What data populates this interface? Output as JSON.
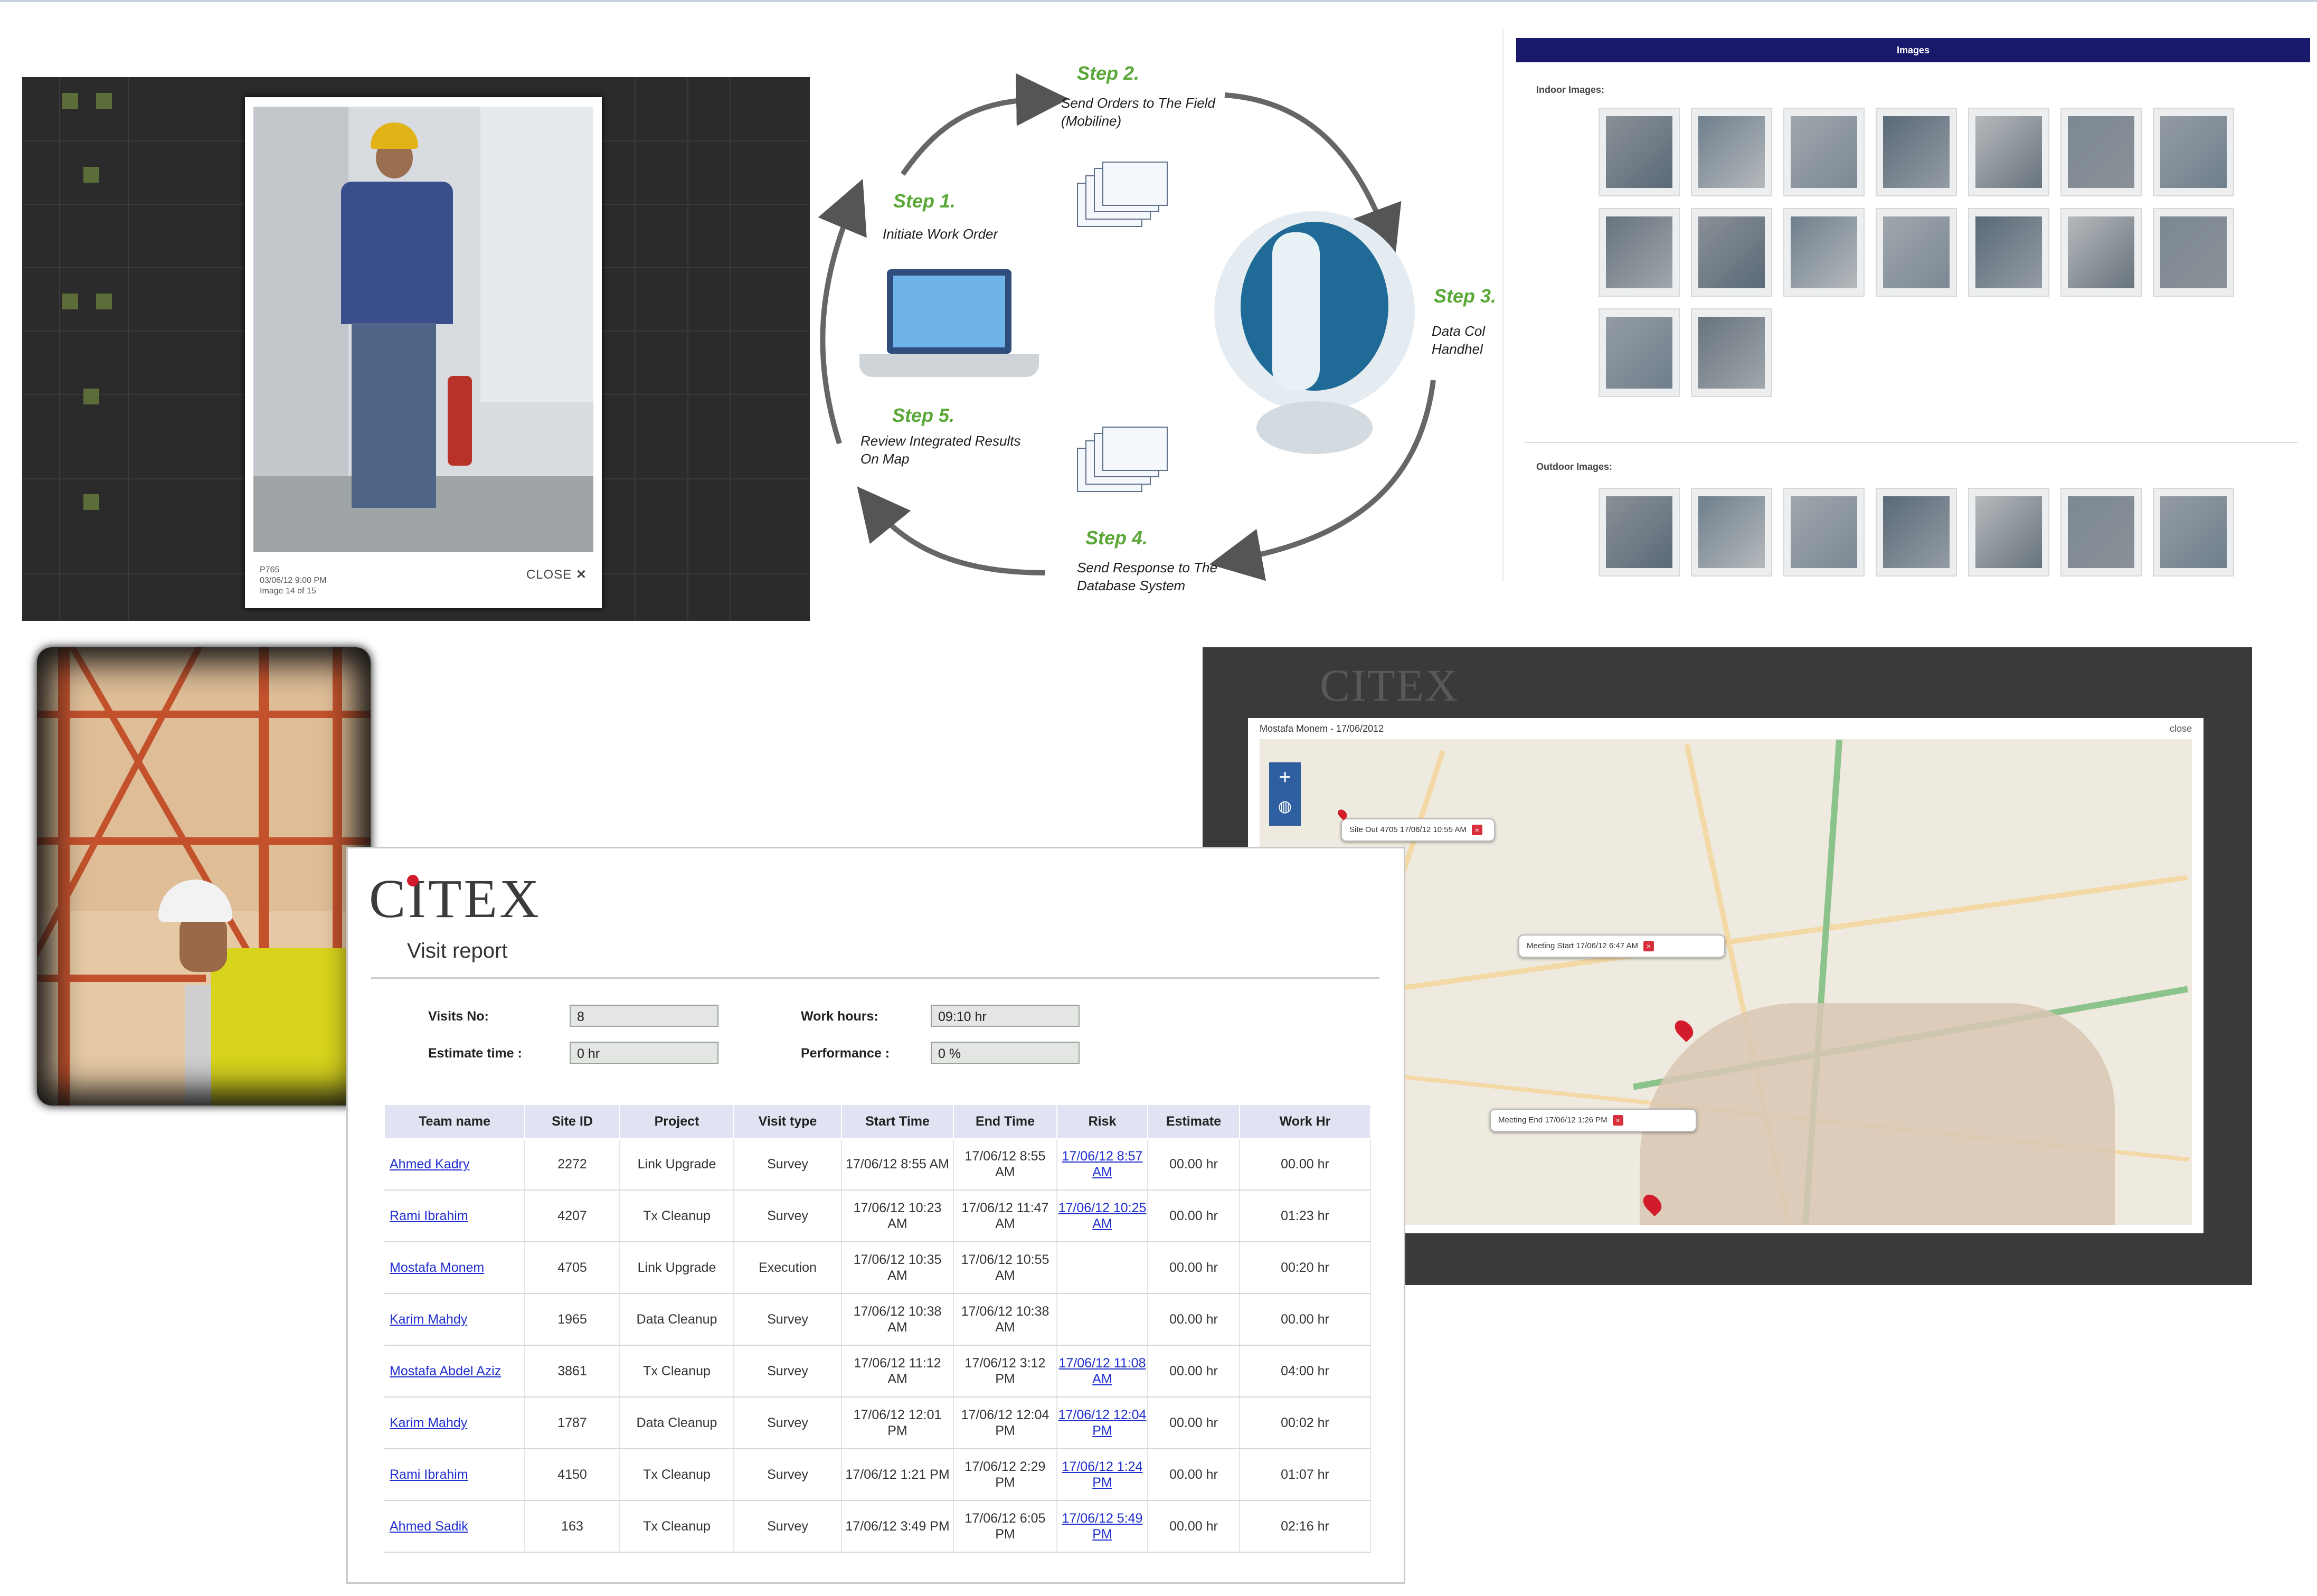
{
  "panel_site_visit": {
    "close_label": "CLOSE",
    "close_icon": "x-icon",
    "caption_lines": [
      "P765",
      "03/06/12 9:00 PM",
      "Image 14 of 15"
    ]
  },
  "workflow": {
    "steps": [
      {
        "title": "Step 1.",
        "desc": "Initiate Work Order"
      },
      {
        "title": "Step 2.",
        "desc": "Send Orders to The Field  (Mobiline)"
      },
      {
        "title": "Step 3.",
        "desc": "Data Col Handhel"
      },
      {
        "title": "Step 4.",
        "desc": "Send Response to The Database System"
      },
      {
        "title": "Step 5.",
        "desc": "Review Integrated Results On Map"
      }
    ],
    "accent_color": "#5aa838"
  },
  "images_panel": {
    "header": "Images",
    "indoor_label": "Indoor Images:",
    "outdoor_label": "Outdoor Images:",
    "indoor_count": 16,
    "outdoor_count": 7
  },
  "map_panel": {
    "logo": "CITEX",
    "title": "Mostafa Monem - 17/06/2012",
    "close_label": "close",
    "zoom_in": "+",
    "bubbles": [
      {
        "text": "Site Out 4705 17/06/12 10:55 AM"
      },
      {
        "text": "Meeting Start 17/06/12 6:47 AM"
      },
      {
        "text": "Meeting End 17/06/12 1:26 PM"
      }
    ]
  },
  "visit_report": {
    "logo": "CITEX",
    "subtitle": "Visit report",
    "fields": {
      "visits_label": "Visits No:",
      "visits_value": "8",
      "work_hours_label": "Work hours:",
      "work_hours_value": "09:10 hr",
      "estimate_label": "Estimate time :",
      "estimate_value": "0 hr",
      "performance_label": "Performance :",
      "performance_value": "0 %"
    },
    "columns": [
      "Team name",
      "Site ID",
      "Project",
      "Visit type",
      "Start Time",
      "End Time",
      "Risk",
      "Estimate",
      "Work Hr"
    ],
    "rows": [
      {
        "team": "Ahmed Kadry",
        "site": "2272",
        "project": "Link Upgrade",
        "visit": "Survey",
        "start": "17/06/12 8:55 AM",
        "end": "17/06/12 8:55 AM",
        "risk": "17/06/12 8:57 AM",
        "estimate": "00.00 hr",
        "work": "00.00 hr"
      },
      {
        "team": "Rami Ibrahim",
        "site": "4207",
        "project": "Tx Cleanup",
        "visit": "Survey",
        "start": "17/06/12 10:23 AM",
        "end": "17/06/12 11:47 AM",
        "risk": "17/06/12 10:25 AM",
        "estimate": "00.00 hr",
        "work": "01:23 hr"
      },
      {
        "team": "Mostafa Monem",
        "site": "4705",
        "project": "Link Upgrade",
        "visit": "Execution",
        "start": "17/06/12 10:35 AM",
        "end": "17/06/12 10:55 AM",
        "risk": "",
        "estimate": "00.00 hr",
        "work": "00:20 hr"
      },
      {
        "team": "Karim Mahdy",
        "site": "1965",
        "project": "Data Cleanup",
        "visit": "Survey",
        "start": "17/06/12 10:38 AM",
        "end": "17/06/12 10:38 AM",
        "risk": "",
        "estimate": "00.00 hr",
        "work": "00.00 hr"
      },
      {
        "team": "Mostafa Abdel Aziz",
        "site": "3861",
        "project": "Tx Cleanup",
        "visit": "Survey",
        "start": "17/06/12 11:12 AM",
        "end": "17/06/12 3:12 PM",
        "risk": "17/06/12 11:08 AM",
        "estimate": "00.00 hr",
        "work": "04:00 hr"
      },
      {
        "team": "Karim Mahdy",
        "site": "1787",
        "project": "Data Cleanup",
        "visit": "Survey",
        "start": "17/06/12 12:01 PM",
        "end": "17/06/12 12:04 PM",
        "risk": "17/06/12 12:04 PM",
        "estimate": "00.00 hr",
        "work": "00:02 hr"
      },
      {
        "team": "Rami Ibrahim",
        "site": "4150",
        "project": "Tx Cleanup",
        "visit": "Survey",
        "start": "17/06/12 1:21 PM",
        "end": "17/06/12 2:29 PM",
        "risk": "17/06/12 1:24 PM",
        "estimate": "00.00 hr",
        "work": "01:07 hr"
      },
      {
        "team": "Ahmed Sadik",
        "site": "163",
        "project": "Tx Cleanup",
        "visit": "Survey",
        "start": "17/06/12 3:49 PM",
        "end": "17/06/12 6:05 PM",
        "risk": "17/06/12 5:49 PM",
        "estimate": "00.00 hr",
        "work": "02:16 hr"
      }
    ],
    "link_color": "#1f2fd0",
    "header_color": "#e0e3f2"
  },
  "colors": {
    "dark_panel": "#2b2b2b",
    "images_header": "#18196b",
    "map_pin": "#d21c2c"
  }
}
